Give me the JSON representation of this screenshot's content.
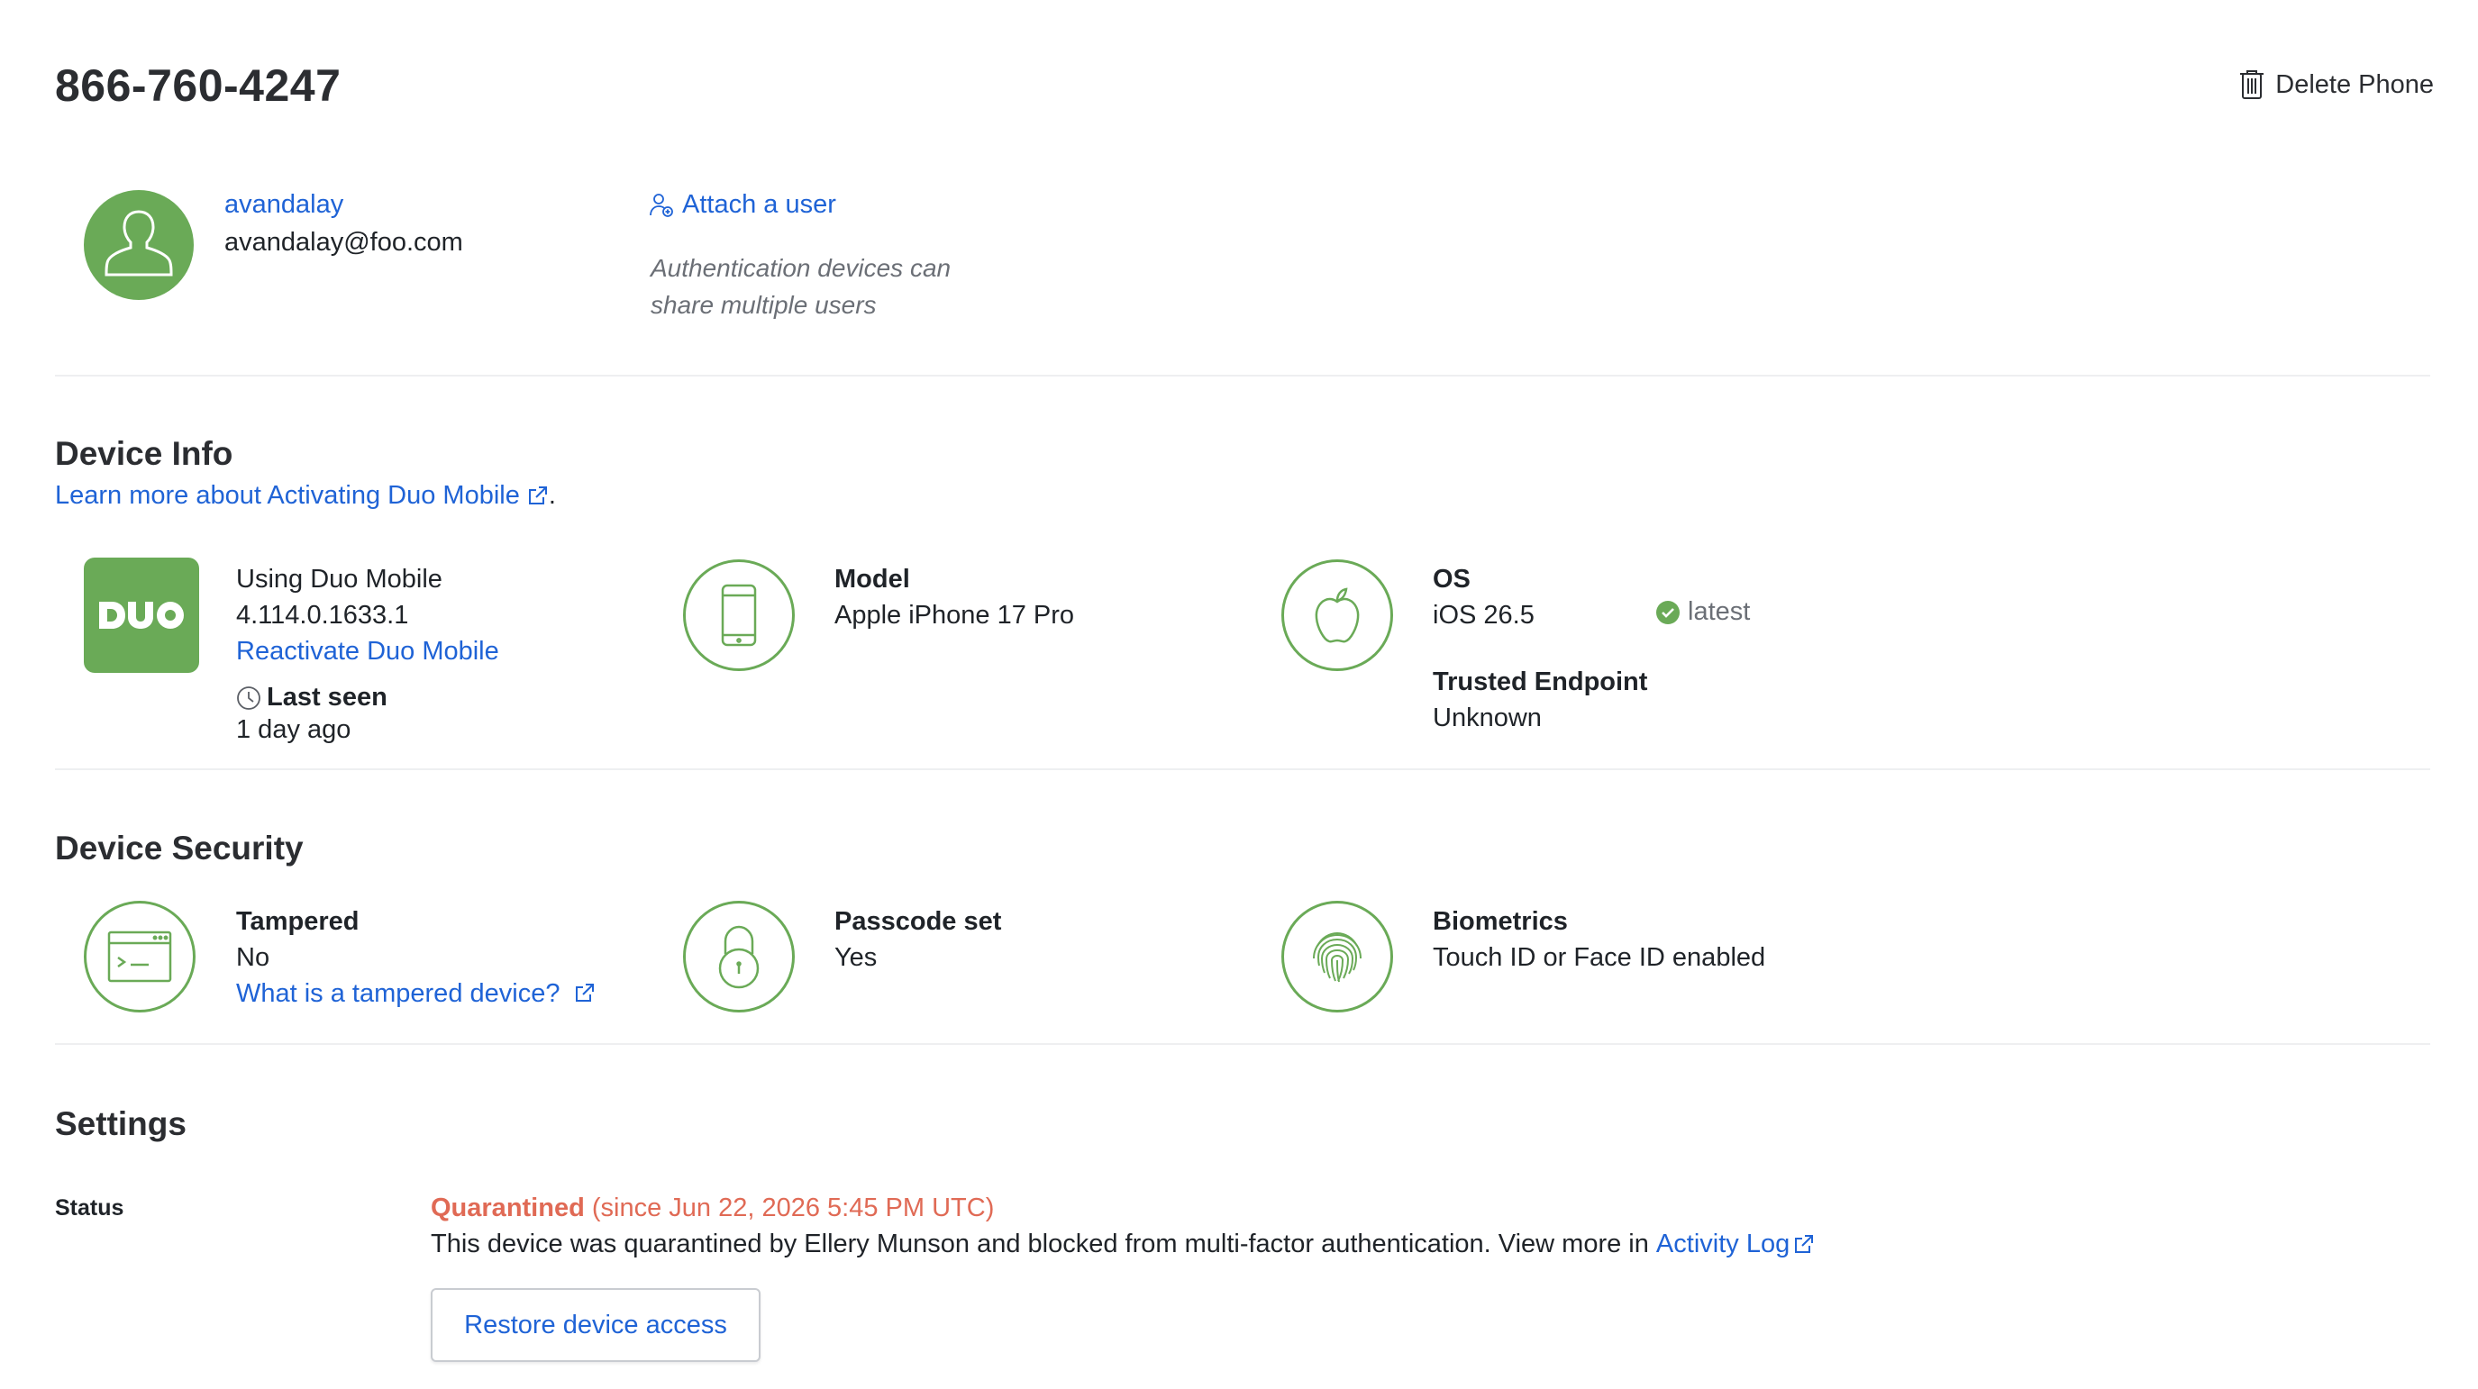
{
  "header": {
    "title": "866-760-4247",
    "delete_label": "Delete Phone"
  },
  "user": {
    "username": "avandalay",
    "email": "avandalay@foo.com",
    "attach_label": "Attach a user",
    "attach_help_line1": "Authentication devices can",
    "attach_help_line2": "share multiple users"
  },
  "device_info": {
    "heading": "Device Info",
    "learn_more": "Learn more about Activating Duo Mobile",
    "learn_more_suffix": ".",
    "app": {
      "name": "Using Duo Mobile",
      "version": "4.114.0.1633.1",
      "reactivate": "Reactivate Duo Mobile",
      "last_seen_label": "Last seen",
      "last_seen_value": "1 day ago"
    },
    "model": {
      "label": "Model",
      "value": "Apple iPhone 17 Pro"
    },
    "os": {
      "label": "OS",
      "value": "iOS 26.5",
      "badge": "latest"
    },
    "trusted": {
      "label": "Trusted Endpoint",
      "value": "Unknown"
    }
  },
  "device_security": {
    "heading": "Device Security",
    "tampered": {
      "label": "Tampered",
      "value": "No",
      "link": "What is a tampered device?"
    },
    "passcode": {
      "label": "Passcode set",
      "value": "Yes"
    },
    "biometrics": {
      "label": "Biometrics",
      "value": "Touch ID or Face ID enabled"
    }
  },
  "settings": {
    "heading": "Settings",
    "status_label": "Status",
    "status_value": "Quarantined",
    "status_since": " (since Jun 22, 2026 5:45 PM UTC)",
    "description": "This device was quarantined by Ellery Munson and blocked from multi-factor authentication. View more in ",
    "activity_log": "Activity Log",
    "restore_button": "Restore device access"
  },
  "colors": {
    "accent": "#6aaa57",
    "link": "#1f63d6",
    "warning": "#e06a55"
  }
}
